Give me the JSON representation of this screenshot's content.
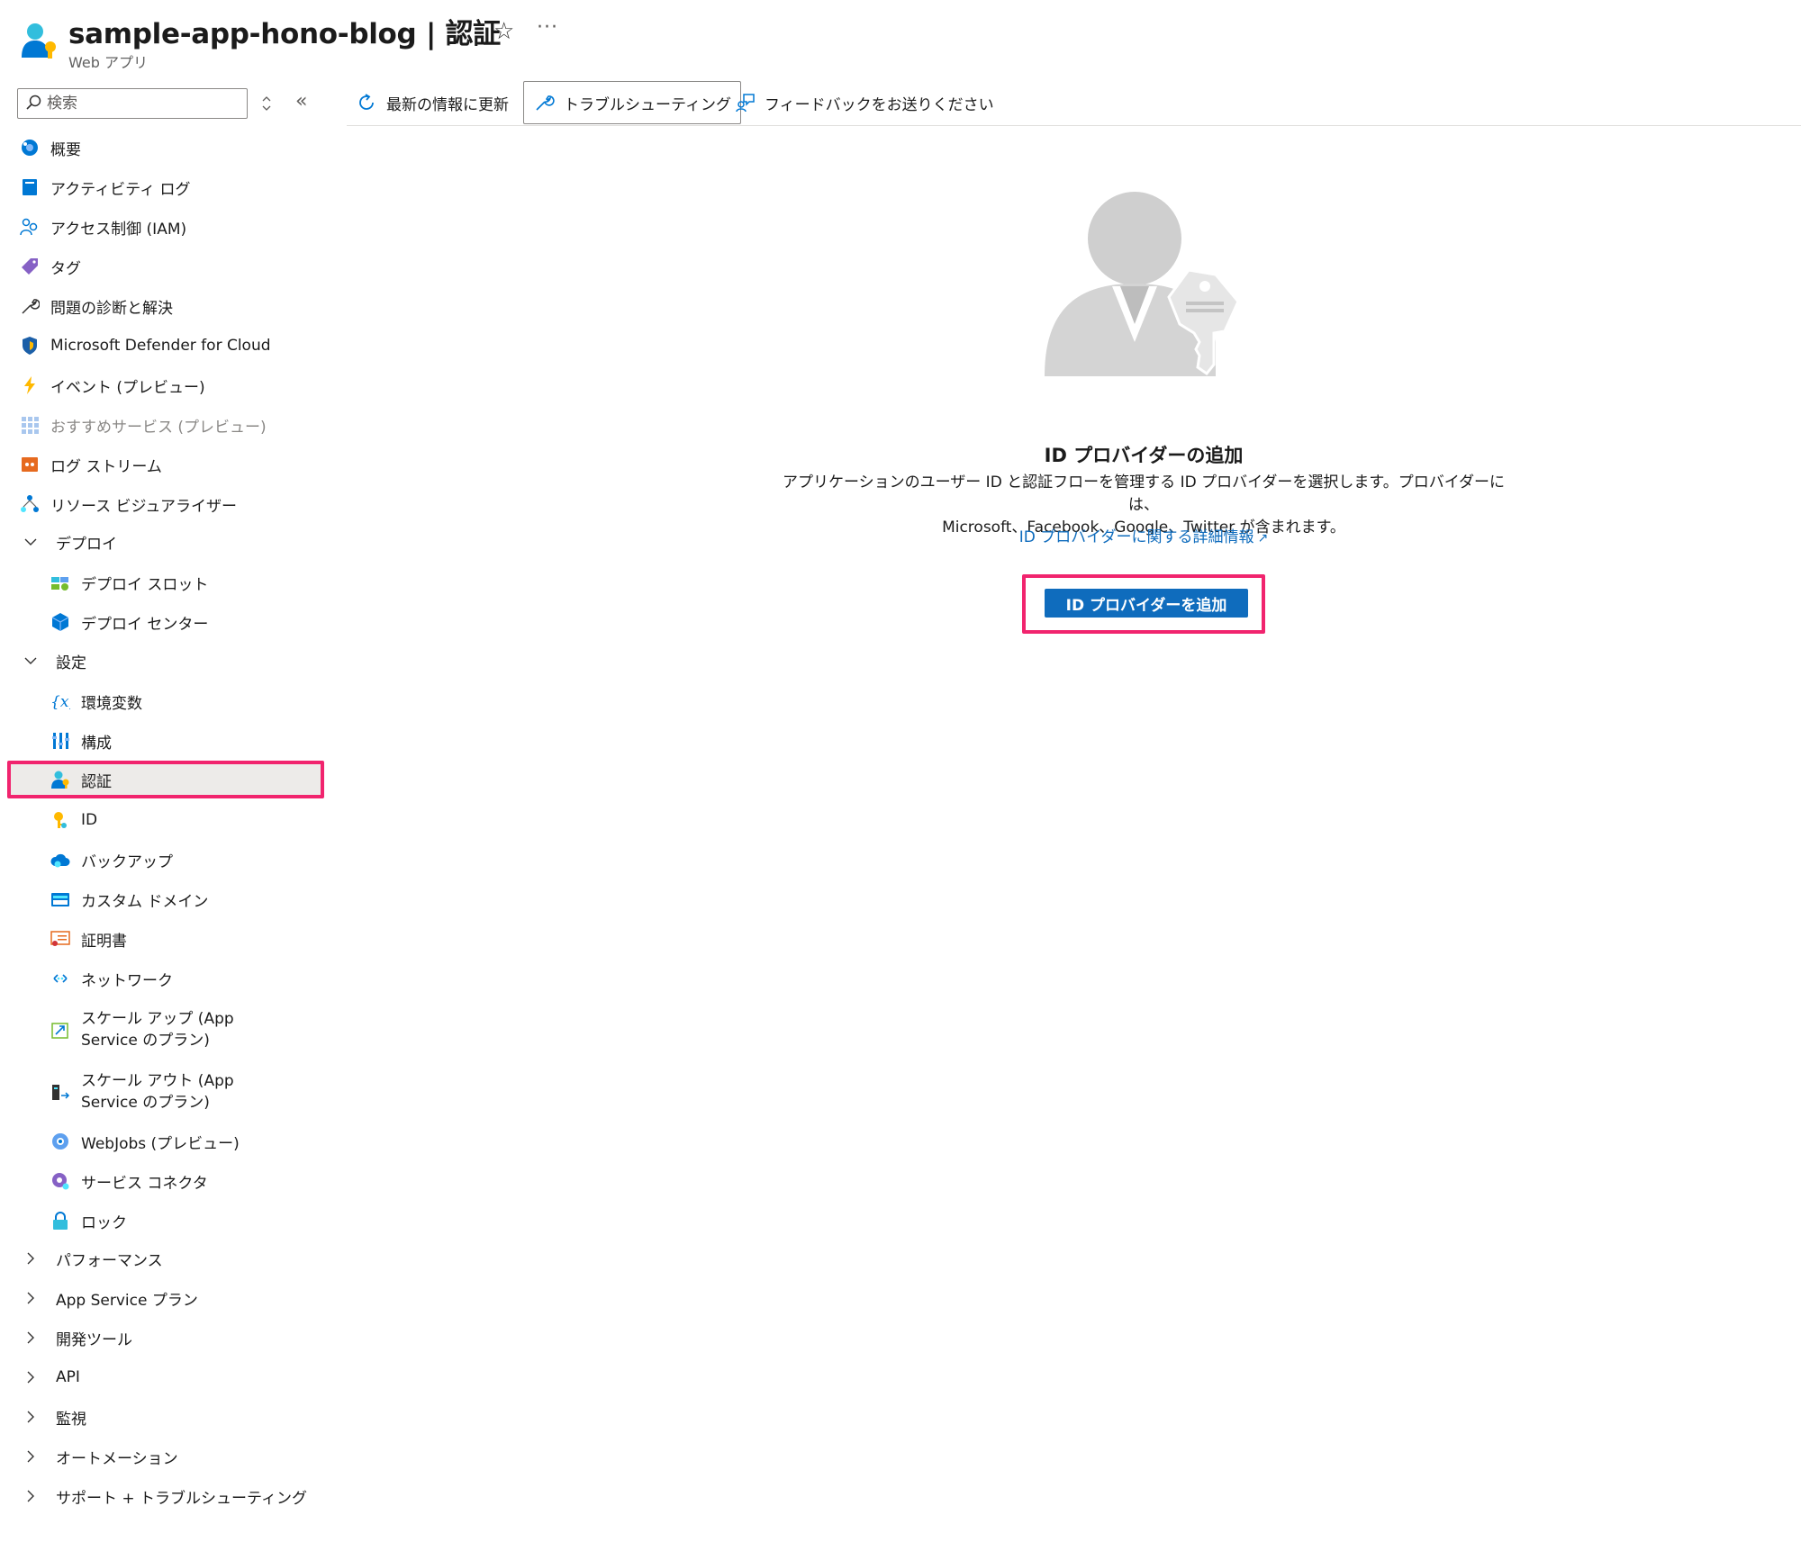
{
  "header": {
    "title": "sample-app-hono-blog | 認証",
    "subtitle": "Web アプリ",
    "favorite_icon": "star-icon",
    "more_icon": "ellipsis-icon"
  },
  "sidebar": {
    "search": {
      "placeholder": "検索",
      "value": ""
    },
    "items": [
      {
        "label": "概要",
        "icon": "overview-icon"
      },
      {
        "label": "アクティビティ ログ",
        "icon": "activity-log-icon"
      },
      {
        "label": "アクセス制御 (IAM)",
        "icon": "iam-icon"
      },
      {
        "label": "タグ",
        "icon": "tag-icon"
      },
      {
        "label": "問題の診断と解決",
        "icon": "wrench-icon"
      },
      {
        "label": "Microsoft Defender for Cloud",
        "icon": "defender-shield-icon"
      },
      {
        "label": "イベント (プレビュー)",
        "icon": "lightning-icon"
      },
      {
        "label": "おすすめサービス (プレビュー)",
        "icon": "grid-icon"
      },
      {
        "label": "ログ ストリーム",
        "icon": "log-stream-icon"
      },
      {
        "label": "リソース ビジュアライザー",
        "icon": "resource-visualizer-icon"
      }
    ],
    "groups": {
      "deploy": {
        "label": "デプロイ",
        "items": [
          {
            "label": "デプロイ スロット",
            "icon": "deployment-slots-icon"
          },
          {
            "label": "デプロイ センター",
            "icon": "deployment-center-icon"
          }
        ]
      },
      "settings": {
        "label": "設定",
        "items": [
          {
            "label": "環境変数",
            "icon": "variable-icon"
          },
          {
            "label": "構成",
            "icon": "configuration-icon"
          },
          {
            "label": "認証",
            "icon": "authentication-icon",
            "selected": true
          },
          {
            "label": "ID",
            "icon": "identity-key-icon"
          },
          {
            "label": "バックアップ",
            "icon": "backup-cloud-icon"
          },
          {
            "label": "カスタム ドメイン",
            "icon": "custom-domain-icon"
          },
          {
            "label": "証明書",
            "icon": "certificate-icon"
          },
          {
            "label": "ネットワーク",
            "icon": "network-icon"
          },
          {
            "label": "スケール アップ (App Service のプラン)",
            "icon": "scale-up-icon"
          },
          {
            "label": "スケール アウト (App Service のプラン)",
            "icon": "scale-out-icon"
          },
          {
            "label": "WebJobs (プレビュー)",
            "icon": "webjobs-icon"
          },
          {
            "label": "サービス コネクタ",
            "icon": "service-connector-icon"
          },
          {
            "label": "ロック",
            "icon": "lock-icon"
          }
        ]
      }
    },
    "collapsed_groups": [
      {
        "label": "パフォーマンス"
      },
      {
        "label": "App Service プラン"
      },
      {
        "label": "開発ツール"
      },
      {
        "label": "API"
      },
      {
        "label": "監視"
      },
      {
        "label": "オートメーション"
      },
      {
        "label": "サポート + トラブルシューティング"
      }
    ]
  },
  "toolbar": {
    "refresh_label": "最新の情報に更新",
    "troubleshoot_label": "トラブルシューティング",
    "feedback_label": "フィードバックをお送りください"
  },
  "main": {
    "title": "ID プロバイダーの追加",
    "description_line1": "アプリケーションのユーザー ID と認証フローを管理する ID プロバイダーを選択します。プロバイダーには、",
    "description_line2": "Microsoft、Facebook、Google、Twitter が含まれます。",
    "learn_more_link": "ID プロバイダーに関する詳細情報",
    "add_button_label": "ID プロバイダーを追加"
  },
  "colors": {
    "accent": "#0f6cbd",
    "highlight": "#f1246e",
    "selected_background": "#edebe9"
  }
}
